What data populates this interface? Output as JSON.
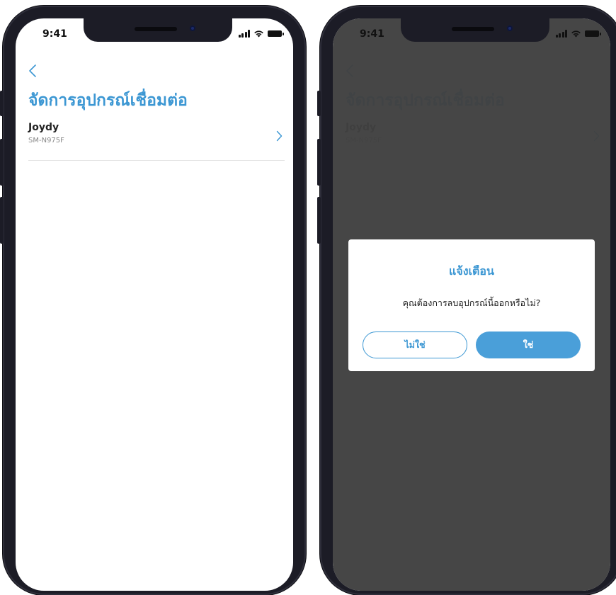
{
  "status_bar": {
    "time": "9:41"
  },
  "page": {
    "title": "จัดการอุปกรณ์เชื่อมต่อ"
  },
  "device": {
    "name": "Joydy",
    "model": "SM-N975F"
  },
  "dialog": {
    "title": "แจ้งเตือน",
    "message": "คุณต้องการลบอุปกรณ์นี้ออกหรือไม่?",
    "no_label": "ไม่ใช่",
    "yes_label": "ใช่"
  },
  "colors": {
    "accent": "#3c97d3",
    "overlay": "#404040",
    "frame": "#1c1c26"
  },
  "icons": {
    "back": "chevron-left-icon",
    "row_arrow": "chevron-right-icon",
    "signal": "cellular-signal-icon",
    "wifi": "wifi-icon",
    "battery": "battery-icon"
  }
}
